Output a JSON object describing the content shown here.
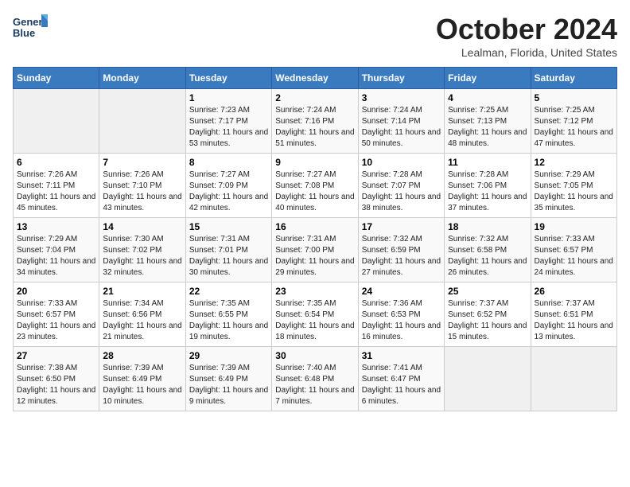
{
  "header": {
    "logo_line1": "General",
    "logo_line2": "Blue",
    "month_title": "October 2024",
    "location": "Lealman, Florida, United States"
  },
  "days_of_week": [
    "Sunday",
    "Monday",
    "Tuesday",
    "Wednesday",
    "Thursday",
    "Friday",
    "Saturday"
  ],
  "weeks": [
    [
      {
        "num": "",
        "sunrise": "",
        "sunset": "",
        "daylight": ""
      },
      {
        "num": "",
        "sunrise": "",
        "sunset": "",
        "daylight": ""
      },
      {
        "num": "1",
        "sunrise": "Sunrise: 7:23 AM",
        "sunset": "Sunset: 7:17 PM",
        "daylight": "Daylight: 11 hours and 53 minutes."
      },
      {
        "num": "2",
        "sunrise": "Sunrise: 7:24 AM",
        "sunset": "Sunset: 7:16 PM",
        "daylight": "Daylight: 11 hours and 51 minutes."
      },
      {
        "num": "3",
        "sunrise": "Sunrise: 7:24 AM",
        "sunset": "Sunset: 7:14 PM",
        "daylight": "Daylight: 11 hours and 50 minutes."
      },
      {
        "num": "4",
        "sunrise": "Sunrise: 7:25 AM",
        "sunset": "Sunset: 7:13 PM",
        "daylight": "Daylight: 11 hours and 48 minutes."
      },
      {
        "num": "5",
        "sunrise": "Sunrise: 7:25 AM",
        "sunset": "Sunset: 7:12 PM",
        "daylight": "Daylight: 11 hours and 47 minutes."
      }
    ],
    [
      {
        "num": "6",
        "sunrise": "Sunrise: 7:26 AM",
        "sunset": "Sunset: 7:11 PM",
        "daylight": "Daylight: 11 hours and 45 minutes."
      },
      {
        "num": "7",
        "sunrise": "Sunrise: 7:26 AM",
        "sunset": "Sunset: 7:10 PM",
        "daylight": "Daylight: 11 hours and 43 minutes."
      },
      {
        "num": "8",
        "sunrise": "Sunrise: 7:27 AM",
        "sunset": "Sunset: 7:09 PM",
        "daylight": "Daylight: 11 hours and 42 minutes."
      },
      {
        "num": "9",
        "sunrise": "Sunrise: 7:27 AM",
        "sunset": "Sunset: 7:08 PM",
        "daylight": "Daylight: 11 hours and 40 minutes."
      },
      {
        "num": "10",
        "sunrise": "Sunrise: 7:28 AM",
        "sunset": "Sunset: 7:07 PM",
        "daylight": "Daylight: 11 hours and 38 minutes."
      },
      {
        "num": "11",
        "sunrise": "Sunrise: 7:28 AM",
        "sunset": "Sunset: 7:06 PM",
        "daylight": "Daylight: 11 hours and 37 minutes."
      },
      {
        "num": "12",
        "sunrise": "Sunrise: 7:29 AM",
        "sunset": "Sunset: 7:05 PM",
        "daylight": "Daylight: 11 hours and 35 minutes."
      }
    ],
    [
      {
        "num": "13",
        "sunrise": "Sunrise: 7:29 AM",
        "sunset": "Sunset: 7:04 PM",
        "daylight": "Daylight: 11 hours and 34 minutes."
      },
      {
        "num": "14",
        "sunrise": "Sunrise: 7:30 AM",
        "sunset": "Sunset: 7:02 PM",
        "daylight": "Daylight: 11 hours and 32 minutes."
      },
      {
        "num": "15",
        "sunrise": "Sunrise: 7:31 AM",
        "sunset": "Sunset: 7:01 PM",
        "daylight": "Daylight: 11 hours and 30 minutes."
      },
      {
        "num": "16",
        "sunrise": "Sunrise: 7:31 AM",
        "sunset": "Sunset: 7:00 PM",
        "daylight": "Daylight: 11 hours and 29 minutes."
      },
      {
        "num": "17",
        "sunrise": "Sunrise: 7:32 AM",
        "sunset": "Sunset: 6:59 PM",
        "daylight": "Daylight: 11 hours and 27 minutes."
      },
      {
        "num": "18",
        "sunrise": "Sunrise: 7:32 AM",
        "sunset": "Sunset: 6:58 PM",
        "daylight": "Daylight: 11 hours and 26 minutes."
      },
      {
        "num": "19",
        "sunrise": "Sunrise: 7:33 AM",
        "sunset": "Sunset: 6:57 PM",
        "daylight": "Daylight: 11 hours and 24 minutes."
      }
    ],
    [
      {
        "num": "20",
        "sunrise": "Sunrise: 7:33 AM",
        "sunset": "Sunset: 6:57 PM",
        "daylight": "Daylight: 11 hours and 23 minutes."
      },
      {
        "num": "21",
        "sunrise": "Sunrise: 7:34 AM",
        "sunset": "Sunset: 6:56 PM",
        "daylight": "Daylight: 11 hours and 21 minutes."
      },
      {
        "num": "22",
        "sunrise": "Sunrise: 7:35 AM",
        "sunset": "Sunset: 6:55 PM",
        "daylight": "Daylight: 11 hours and 19 minutes."
      },
      {
        "num": "23",
        "sunrise": "Sunrise: 7:35 AM",
        "sunset": "Sunset: 6:54 PM",
        "daylight": "Daylight: 11 hours and 18 minutes."
      },
      {
        "num": "24",
        "sunrise": "Sunrise: 7:36 AM",
        "sunset": "Sunset: 6:53 PM",
        "daylight": "Daylight: 11 hours and 16 minutes."
      },
      {
        "num": "25",
        "sunrise": "Sunrise: 7:37 AM",
        "sunset": "Sunset: 6:52 PM",
        "daylight": "Daylight: 11 hours and 15 minutes."
      },
      {
        "num": "26",
        "sunrise": "Sunrise: 7:37 AM",
        "sunset": "Sunset: 6:51 PM",
        "daylight": "Daylight: 11 hours and 13 minutes."
      }
    ],
    [
      {
        "num": "27",
        "sunrise": "Sunrise: 7:38 AM",
        "sunset": "Sunset: 6:50 PM",
        "daylight": "Daylight: 11 hours and 12 minutes."
      },
      {
        "num": "28",
        "sunrise": "Sunrise: 7:39 AM",
        "sunset": "Sunset: 6:49 PM",
        "daylight": "Daylight: 11 hours and 10 minutes."
      },
      {
        "num": "29",
        "sunrise": "Sunrise: 7:39 AM",
        "sunset": "Sunset: 6:49 PM",
        "daylight": "Daylight: 11 hours and 9 minutes."
      },
      {
        "num": "30",
        "sunrise": "Sunrise: 7:40 AM",
        "sunset": "Sunset: 6:48 PM",
        "daylight": "Daylight: 11 hours and 7 minutes."
      },
      {
        "num": "31",
        "sunrise": "Sunrise: 7:41 AM",
        "sunset": "Sunset: 6:47 PM",
        "daylight": "Daylight: 11 hours and 6 minutes."
      },
      {
        "num": "",
        "sunrise": "",
        "sunset": "",
        "daylight": ""
      },
      {
        "num": "",
        "sunrise": "",
        "sunset": "",
        "daylight": ""
      }
    ]
  ]
}
